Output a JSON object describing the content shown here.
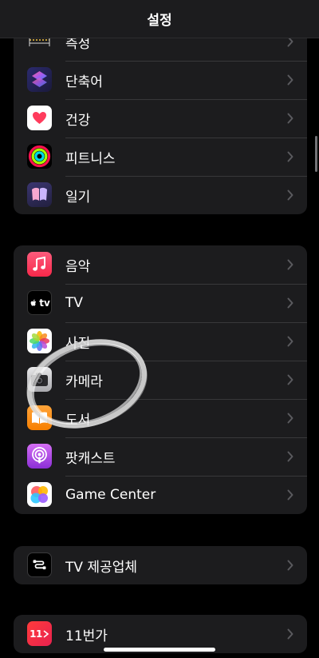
{
  "nav": {
    "title": "설정"
  },
  "groups": [
    {
      "items": [
        {
          "label": "측정",
          "icon": "measure-icon"
        },
        {
          "label": "단축어",
          "icon": "shortcuts-icon"
        },
        {
          "label": "건강",
          "icon": "health-icon"
        },
        {
          "label": "피트니스",
          "icon": "fitness-icon"
        },
        {
          "label": "일기",
          "icon": "journal-icon"
        }
      ]
    },
    {
      "items": [
        {
          "label": "음악",
          "icon": "music-icon"
        },
        {
          "label": "TV",
          "icon": "apple-tv-icon",
          "icon_text": "tv"
        },
        {
          "label": "사진",
          "icon": "photos-icon"
        },
        {
          "label": "카메라",
          "icon": "camera-icon"
        },
        {
          "label": "도서",
          "icon": "books-icon"
        },
        {
          "label": "팟캐스트",
          "icon": "podcasts-icon"
        },
        {
          "label": "Game Center",
          "icon": "game-center-icon"
        }
      ]
    },
    {
      "items": [
        {
          "label": "TV 제공업체",
          "icon": "tv-provider-icon"
        }
      ]
    },
    {
      "items": [
        {
          "label": "11번가",
          "icon": "11st-app-icon",
          "icon_text": "11"
        }
      ]
    }
  ],
  "colors": {
    "background": "#000000",
    "group_background": "#1c1c1e",
    "separator": "#38383a",
    "chevron": "#5a5a5e"
  }
}
